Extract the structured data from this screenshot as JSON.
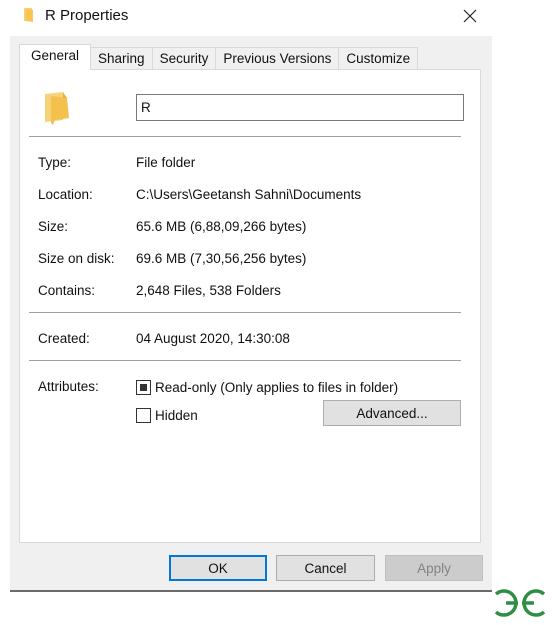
{
  "window": {
    "title": "R Properties",
    "title_icon": "folder-icon",
    "close_icon": "close-icon"
  },
  "tabs": [
    {
      "label": "General",
      "active": true
    },
    {
      "label": "Sharing",
      "active": false
    },
    {
      "label": "Security",
      "active": false
    },
    {
      "label": "Previous Versions",
      "active": false
    },
    {
      "label": "Customize",
      "active": false
    }
  ],
  "general": {
    "folder_icon": "folder-icon",
    "name_value": "R",
    "properties": [
      {
        "label": "Type:",
        "value": "File folder"
      },
      {
        "label": "Location:",
        "value": "C:\\Users\\Geetansh Sahni\\Documents"
      },
      {
        "label": "Size:",
        "value": "65.6 MB (6,88,09,266 bytes)"
      },
      {
        "label": "Size on disk:",
        "value": "69.6 MB (7,30,56,256 bytes)"
      },
      {
        "label": "Contains:",
        "value": "2,648 Files, 538 Folders"
      }
    ],
    "created": {
      "label": "Created:",
      "value": "04 August 2020, 14:30:08"
    },
    "attributes": {
      "label": "Attributes:",
      "read_only": {
        "label": "Read-only (Only applies to files in folder)",
        "state": "indeterminate"
      },
      "hidden": {
        "label": "Hidden",
        "state": "unchecked"
      },
      "advanced_button": "Advanced..."
    }
  },
  "buttons": {
    "ok": "OK",
    "cancel": "Cancel",
    "apply": "Apply"
  },
  "watermark": {
    "text": "GG",
    "color": "#2f8d46"
  },
  "colors": {
    "accent": "#0078d7",
    "folder": "#f5c85a"
  }
}
